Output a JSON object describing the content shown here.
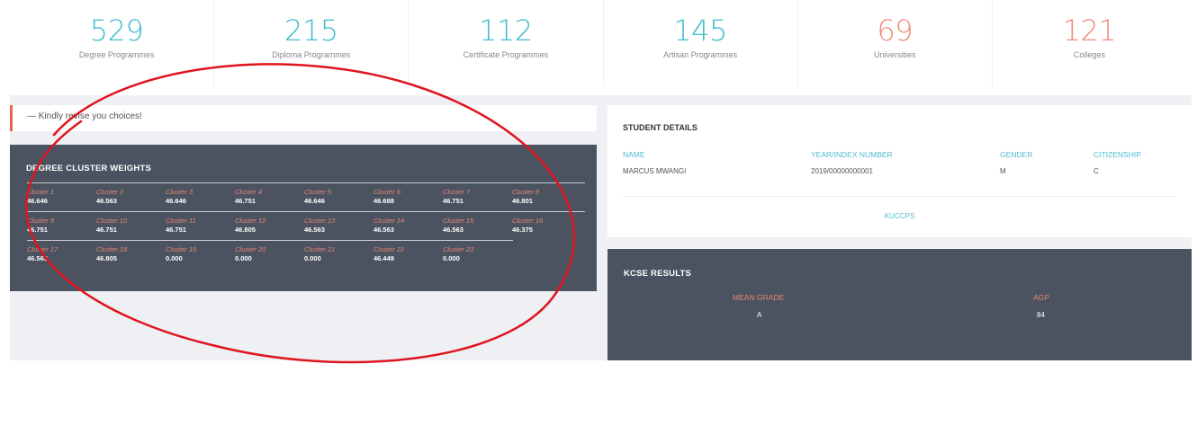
{
  "stats": [
    {
      "value": "529",
      "label": "Degree Programmes",
      "color": "#3fbccd"
    },
    {
      "value": "215",
      "label": "Diploma Programmes",
      "color": "#3fbccd"
    },
    {
      "value": "112",
      "label": "Certificate Programmes",
      "color": "#3fbccd"
    },
    {
      "value": "145",
      "label": "Artisan Programmes",
      "color": "#3fbccd"
    },
    {
      "value": "69",
      "label": "Universities",
      "color": "#f08a78"
    },
    {
      "value": "121",
      "label": "Colleges",
      "color": "#f08a78"
    }
  ],
  "alert": {
    "text": "— Kindly revise you choices!"
  },
  "cluster_weights": {
    "title": "DEGREE CLUSTER WEIGHTS",
    "rows": [
      [
        {
          "name": "Cluster 1",
          "value": "46.646"
        },
        {
          "name": "Cluster 2",
          "value": "46.563"
        },
        {
          "name": "Cluster 3",
          "value": "46.646"
        },
        {
          "name": "Cluster 4",
          "value": "46.751"
        },
        {
          "name": "Cluster 5",
          "value": "46.646"
        },
        {
          "name": "Cluster 6",
          "value": "46.688"
        },
        {
          "name": "Cluster 7",
          "value": "46.751"
        },
        {
          "name": "Cluster 8",
          "value": "46.801"
        }
      ],
      [
        {
          "name": "Cluster 9",
          "value": "46.751"
        },
        {
          "name": "Cluster 10",
          "value": "46.751"
        },
        {
          "name": "Cluster 11",
          "value": "46.751"
        },
        {
          "name": "Cluster 12",
          "value": "46.805"
        },
        {
          "name": "Cluster 13",
          "value": "46.563"
        },
        {
          "name": "Cluster 14",
          "value": "46.563"
        },
        {
          "name": "Cluster 15",
          "value": "46.563"
        },
        {
          "name": "Cluster 16",
          "value": "46.375"
        }
      ],
      [
        {
          "name": "Cluster 17",
          "value": "46.563"
        },
        {
          "name": "Cluster 18",
          "value": "46.805"
        },
        {
          "name": "Cluster 19",
          "value": "0.000"
        },
        {
          "name": "Cluster 20",
          "value": "0.000"
        },
        {
          "name": "Cluster 21",
          "value": "0.000"
        },
        {
          "name": "Cluster 22",
          "value": "46.449"
        },
        {
          "name": "Cluster 23",
          "value": "0.000"
        }
      ]
    ]
  },
  "student": {
    "title": "STUDENT DETAILS",
    "name_label": "NAME",
    "name": "MARCUS MWANGI",
    "index_label": "YEAR/INDEX NUMBER",
    "index": "2019/00000000001",
    "gender_label": "GENDER",
    "gender": "M",
    "citizenship_label": "CITIZENSHIP",
    "citizenship": "C",
    "link": "KUCCPS"
  },
  "kcse": {
    "title": "KCSE RESULTS",
    "mean_grade_label": "MEAN GRADE",
    "mean_grade": "A",
    "agp_label": "AGP",
    "agp": "84"
  },
  "colors": {
    "accent_teal": "#3fbccd",
    "accent_salmon": "#f08a78",
    "panel_dark": "#4b5361",
    "annotation_red": "#e0141e"
  }
}
